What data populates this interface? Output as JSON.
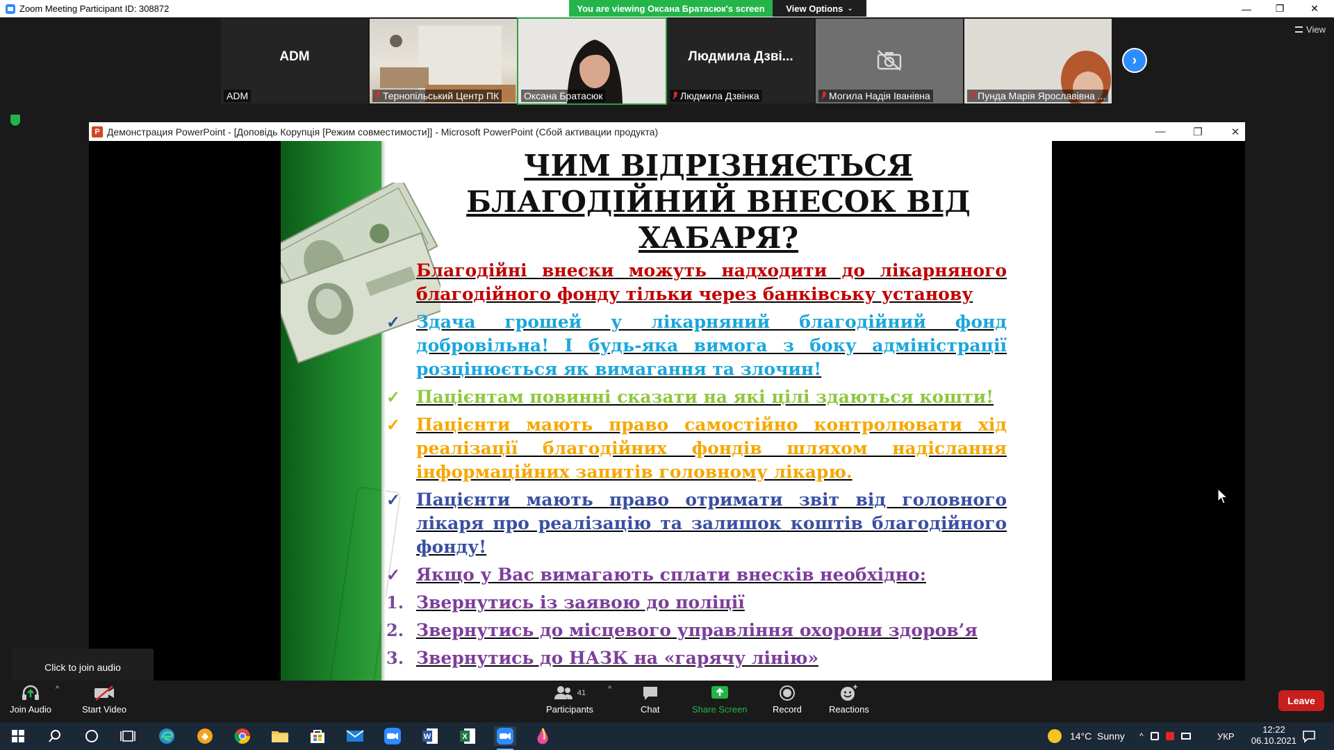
{
  "window": {
    "title": "Zoom Meeting Participant ID: 308872",
    "viewing_banner": "You are viewing Оксана Братасюк's screen",
    "view_options": "View Options"
  },
  "gallery": {
    "view_label": "View",
    "tiles": [
      {
        "name": "ADM",
        "center": "ADM",
        "muted": false,
        "kind": "name"
      },
      {
        "name": "Тернопільський Центр ПК",
        "center": "",
        "muted": true,
        "kind": "room"
      },
      {
        "name": "Оксана Братасюк",
        "center": "",
        "muted": false,
        "kind": "person"
      },
      {
        "name": "Людмила Дзвінка",
        "center": "Людмила Дзві...",
        "muted": true,
        "kind": "name"
      },
      {
        "name": "Могила Надія Іванівна",
        "center": "",
        "muted": true,
        "kind": "camera-off"
      },
      {
        "name": "Пунда Марія Ярославівна ...",
        "center": "",
        "muted": true,
        "kind": "person2"
      }
    ]
  },
  "ppt": {
    "icon_letter": "P",
    "title": "Демонстрация PowerPoint - [Доповідь Корупція [Режим совместимости]] - Microsoft PowerPoint (Сбой активации продукта)",
    "slide": {
      "title": "ЧИМ ВІДРІЗНЯЄТЬСЯ БЛАГОДІЙНИЙ ВНЕСОК ВІД ХАБАРЯ?",
      "paragraphs": [
        {
          "marker": "",
          "text": "Благодійні внески можуть надходити до лікарняного благодійного фонду тільки через банківську установу",
          "color": "#c00000"
        },
        {
          "marker": "✓",
          "text": "Здача грошей у лікарняний благодійний фонд добровільна! І будь-яка вимога з боку адміністрації розцінюється як вимагання та злочин!",
          "color": "#1aa7dd"
        },
        {
          "marker": "✓",
          "text": "Пацієнтам повинні сказати на які цілі здаються кошти!",
          "color": "#8fc83e"
        },
        {
          "marker": "✓",
          "text": "Пацієнти мають право самостійно контролювати хід реалізації благодійних фондів шляхом надіслання інформаційних запитів головному лікарю.",
          "color": "#f6a800"
        },
        {
          "marker": "✓",
          "text": "Пацієнти мають право отримати звіт від головного лікаря про реалізацію та залишок коштів благодійного фонду!",
          "color": "#3a4fa3"
        },
        {
          "marker": "✓",
          "text": "Якщо у Вас вимагають сплати внесків необхідно:",
          "color": "#7d3e9b"
        }
      ],
      "steps": [
        {
          "num": "1.",
          "text": "Звернутись із заявою до поліції"
        },
        {
          "num": "2.",
          "text": "Звернутись до місцевого управління охорони здоров’я"
        },
        {
          "num": "3.",
          "text": "Звернутись до НАЗК на «гарячу лінію»"
        }
      ]
    }
  },
  "tooltip": "Click to join audio",
  "toolbar": {
    "join_audio": "Join Audio",
    "start_video": "Start Video",
    "participants": "Participants",
    "participants_count": "41",
    "chat": "Chat",
    "share_screen": "Share Screen",
    "record": "Record",
    "reactions": "Reactions",
    "leave": "Leave"
  },
  "taskbar": {
    "weather": "14°C  Sunny",
    "language": "УКР",
    "time": "12:22",
    "date": "06.10.2021"
  },
  "colors": {
    "zoom_blue": "#2d8cff",
    "banner_green": "#23b54a",
    "leave_red": "#c91e1e",
    "taskbar": "#1b2836"
  }
}
